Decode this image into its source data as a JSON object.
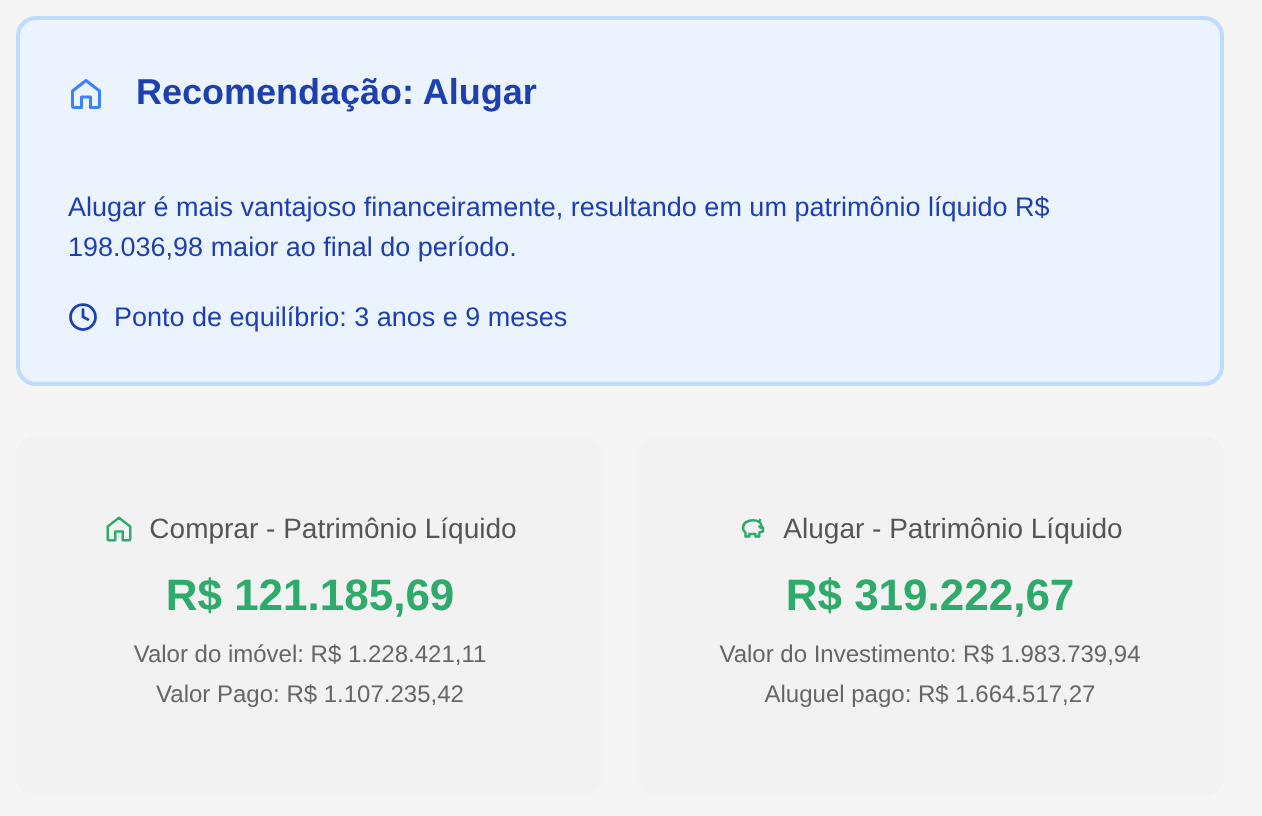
{
  "recommendation": {
    "title": "Recomendação: Alugar",
    "text": "Alugar é mais vantajoso financeiramente, resultando em um patrimônio líquido R$ 198.036,98 maior ao final do período.",
    "breakeven": "Ponto de equilíbrio: 3 anos e 9 meses"
  },
  "cards": [
    {
      "kind": "house",
      "title": "Comprar - Patrimônio Líquido",
      "value": "R$ 121.185,69",
      "details": [
        "Valor do imóvel: R$ 1.228.421,11",
        "Valor Pago: R$ 1.107.235,42"
      ]
    },
    {
      "kind": "piggy",
      "title": "Alugar - Patrimônio Líquido",
      "value": "R$ 319.222,67",
      "details": [
        "Valor do Investimento: R$ 1.983.739,94",
        "Aluguel pago: R$ 1.664.517,27"
      ]
    }
  ]
}
